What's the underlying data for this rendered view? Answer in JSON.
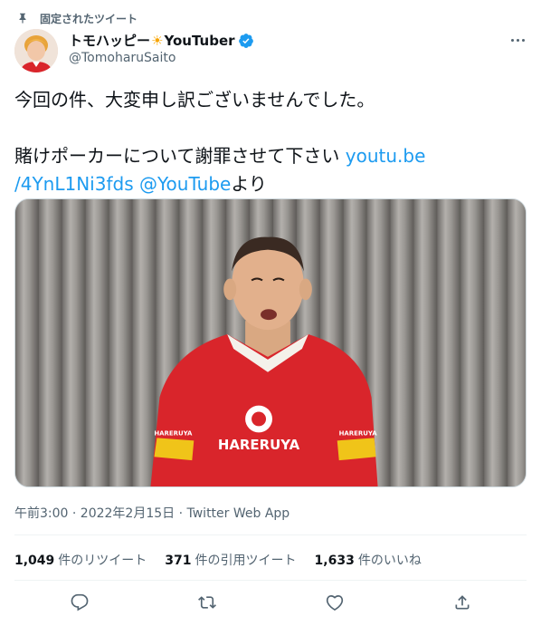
{
  "pinned": {
    "label": "固定されたツイート",
    "icon": "pin-icon"
  },
  "author": {
    "display_name": "トモハッピー",
    "name_emoji": "☀",
    "name_suffix": "YouTuber",
    "handle": "@TomoharuSaito",
    "verified_icon": "verified-badge-icon",
    "more_icon": "more-icon"
  },
  "tweet": {
    "line1": "今回の件、大変申し訳ございませんでした。",
    "line2_text": "賭けポーカーについて謝罪させて下さい ",
    "link": "youtu.be /4YnL1Ni3fds",
    "mention": "@YouTube",
    "suffix": "より"
  },
  "media": {
    "type": "youtube-thumbnail",
    "shirt_text": "HARERUYA",
    "sleeve_text": "HARERUYA"
  },
  "meta": {
    "text": "午前3:00 · 2022年2月15日 · Twitter Web App"
  },
  "stats": [
    {
      "count": "1,049",
      "label": "件のリツイート"
    },
    {
      "count": "371",
      "label": "件の引用ツイート"
    },
    {
      "count": "1,633",
      "label": "件のいいね"
    }
  ],
  "actions": [
    {
      "name": "reply",
      "icon": "reply-icon"
    },
    {
      "name": "retweet",
      "icon": "retweet-icon"
    },
    {
      "name": "like",
      "icon": "like-icon"
    },
    {
      "name": "share",
      "icon": "share-icon"
    }
  ],
  "colors": {
    "link": "#1d9bf0",
    "verified": "#1d9bf0",
    "secondary": "#536471",
    "text": "#0f1419",
    "shirt": "#d9252b"
  }
}
